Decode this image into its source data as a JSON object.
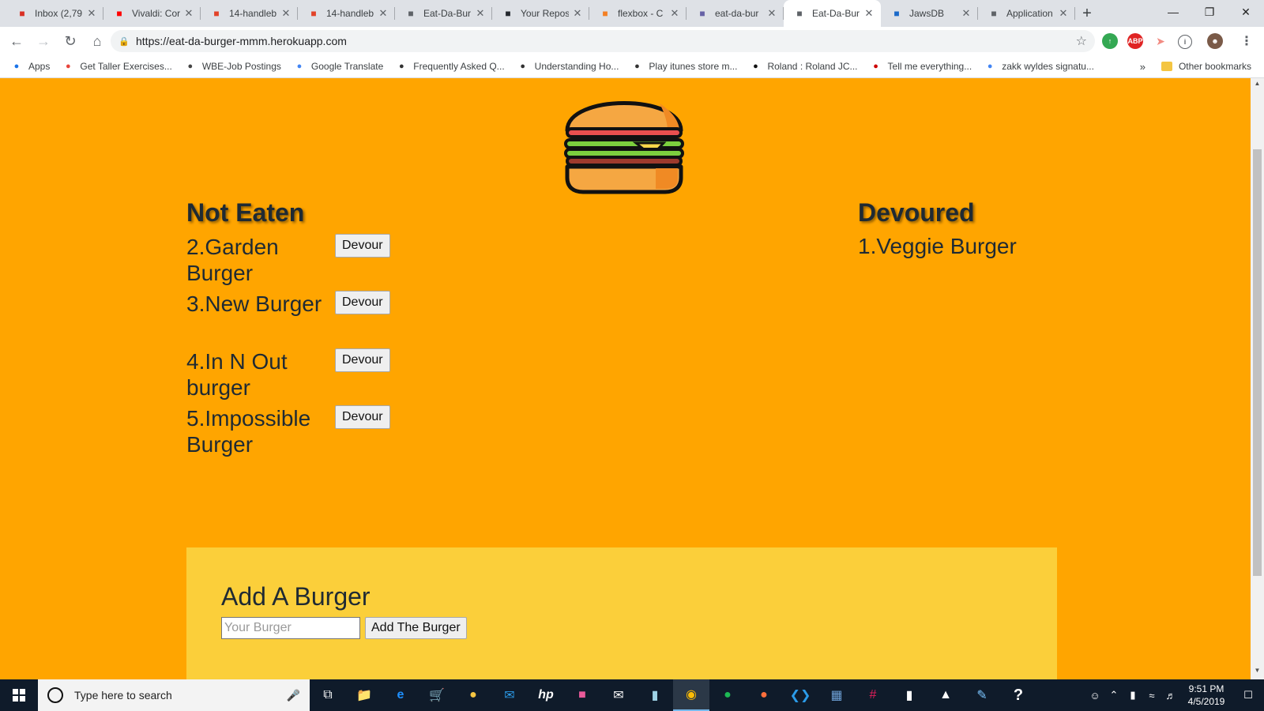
{
  "tabs": [
    {
      "title": "Inbox (2,79",
      "icon": "gmail-icon",
      "color": "#d93025"
    },
    {
      "title": "Vivaldi: Cor",
      "icon": "youtube-icon",
      "color": "#ff0000"
    },
    {
      "title": "14-handleb",
      "icon": "gitlab-icon",
      "color": "#e24329"
    },
    {
      "title": "14-handleb",
      "icon": "gitlab-icon",
      "color": "#e24329"
    },
    {
      "title": "Eat-Da-Bur",
      "icon": "page-icon",
      "color": "#5f6368"
    },
    {
      "title": "Your Repos",
      "icon": "github-icon",
      "color": "#24292e"
    },
    {
      "title": "flexbox - C",
      "icon": "stackoverflow-icon",
      "color": "#f48024"
    },
    {
      "title": "eat-da-bur",
      "icon": "heroku-icon",
      "color": "#6762a6"
    },
    {
      "title": "Eat-Da-Bur",
      "icon": "page-icon",
      "color": "#5f6368",
      "active": true
    },
    {
      "title": "JawsDB",
      "icon": "jawsdb-icon",
      "color": "#1b6ac9"
    },
    {
      "title": "Application",
      "icon": "page-icon",
      "color": "#5f6368"
    }
  ],
  "toolbar": {
    "url": "https://eat-da-burger-mmm.herokuapp.com"
  },
  "bookmarks": [
    {
      "label": "Apps",
      "icon": "apps-grid-icon",
      "color": "#1a73e8"
    },
    {
      "label": "Get Taller Exercises...",
      "icon": "bookmark-icon",
      "color": "#e8453c"
    },
    {
      "label": "WBE-Job Postings",
      "icon": "chevron-icon",
      "color": "#444444"
    },
    {
      "label": "Google Translate",
      "icon": "translate-icon",
      "color": "#4285f4"
    },
    {
      "label": "Frequently Asked Q...",
      "icon": "apple-icon",
      "color": "#333333"
    },
    {
      "label": "Understanding Ho...",
      "icon": "apple-icon",
      "color": "#333333"
    },
    {
      "label": "Play itunes store m...",
      "icon": "apple-icon",
      "color": "#333333"
    },
    {
      "label": "Roland : Roland JC...",
      "icon": "roland-icon",
      "color": "#111111"
    },
    {
      "label": "Tell me everything...",
      "icon": "gear-icon",
      "color": "#cc0000"
    },
    {
      "label": "zakk wyldes signatu...",
      "icon": "google-icon",
      "color": "#4285f4"
    }
  ],
  "bookmarks_more": "»",
  "bookmarks_other": "Other bookmarks",
  "page": {
    "not_eaten_title": "Not Eaten",
    "devoured_title": "Devoured",
    "not_eaten": [
      {
        "name": "2.Garden Burger",
        "button": "Devour"
      },
      {
        "name": "3.New Burger",
        "button": "Devour"
      },
      {
        "name": "4.In N Out burger",
        "button": "Devour"
      },
      {
        "name": "5.Impossible Burger",
        "button": "Devour"
      }
    ],
    "devoured": [
      {
        "name": "1.Veggie Burger"
      }
    ],
    "add_title": "Add A Burger",
    "input_placeholder": "Your Burger",
    "add_button": "Add The Burger",
    "background": "#ffa500",
    "panel_background": "#fbcf3a"
  },
  "taskbar": {
    "search_placeholder": "Type here to search",
    "time": "9:51 PM",
    "date": "4/5/2019"
  }
}
